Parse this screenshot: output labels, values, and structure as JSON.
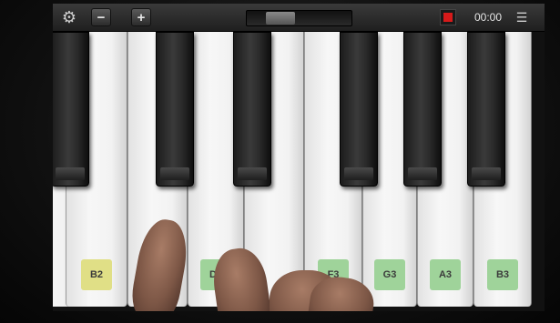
{
  "toolbar": {
    "settings_icon": "gear-icon",
    "zoom_out_label": "−",
    "zoom_in_label": "+",
    "scroll_position": 0.25,
    "record_icon": "record-stop-icon",
    "record_color": "#d61a1a",
    "timer": "00:00",
    "menu_icon": "menu-icon"
  },
  "keyboard": {
    "white_keys": [
      {
        "label": ""
      },
      {
        "label": "B2",
        "root": true
      },
      {
        "label": ""
      },
      {
        "label": "D3"
      },
      {
        "label": ""
      },
      {
        "label": "F3"
      },
      {
        "label": "G3"
      },
      {
        "label": "A3"
      },
      {
        "label": "B3"
      }
    ],
    "label_colors": {
      "note": "#9fd39a",
      "root": "#e0df86"
    }
  }
}
